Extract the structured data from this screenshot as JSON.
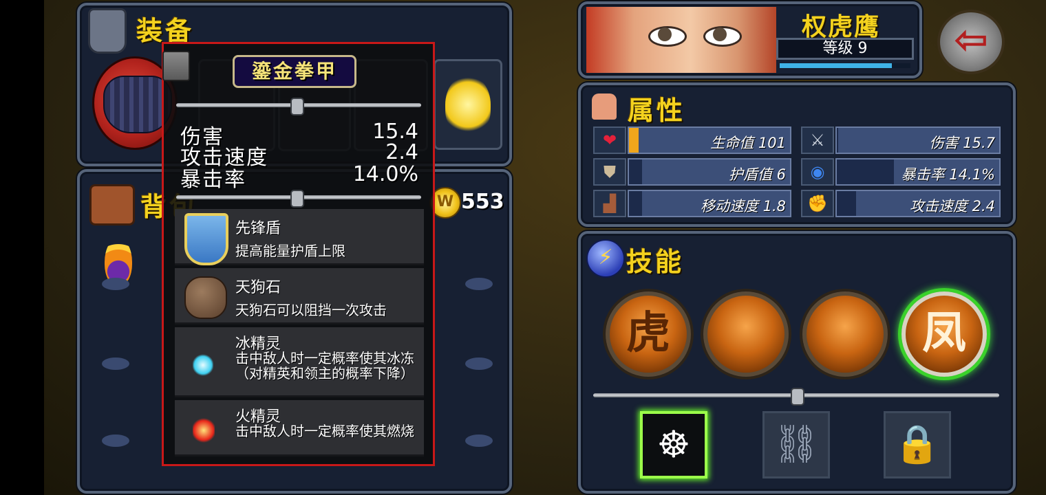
{
  "equipment": {
    "title": "装备"
  },
  "backpack": {
    "title": "背包",
    "coins": "553"
  },
  "tooltip": {
    "item_name": "鎏金拳甲",
    "stats": [
      {
        "label": "伤害",
        "value": "15.4"
      },
      {
        "label": "攻击速度",
        "value": "2.4"
      },
      {
        "label": "暴击率",
        "value": "14.0%"
      }
    ],
    "items": [
      {
        "name": "先锋盾",
        "desc": "提高能量护盾上限",
        "icon": "shield-icon"
      },
      {
        "name": "天狗石",
        "desc": "天狗石可以阻挡一次攻击",
        "icon": "stone-icon"
      },
      {
        "name": "冰精灵",
        "desc": "击中敌人时一定概率使其冰冻（对精英和领主的概率下降）",
        "icon": "ice-spirit-icon"
      },
      {
        "name": "火精灵",
        "desc": "击中敌人时一定概率使其燃烧",
        "icon": "fire-spirit-icon"
      }
    ]
  },
  "character": {
    "name": "权虎鹰",
    "level_text": "等级 9",
    "xp_fraction": 0.86
  },
  "attributes": {
    "title": "属性",
    "list": [
      {
        "label": "生命值 101",
        "icon": "heart-icon",
        "fill": 0.06
      },
      {
        "label": "伤害 15.7",
        "icon": "sword-icon",
        "fill": 0.01
      },
      {
        "label": "护盾值 6",
        "icon": "shield-icon",
        "fill": 0.08
      },
      {
        "label": "暴击率 14.1%",
        "icon": "eye-icon",
        "fill": 0.35
      },
      {
        "label": "移动速度 1.8",
        "icon": "boot-icon",
        "fill": 0.08
      },
      {
        "label": "攻击速度 2.4",
        "icon": "fist-icon",
        "fill": 0.12
      }
    ]
  },
  "skills": {
    "title": "技能",
    "orbs": [
      {
        "glyph": "虎",
        "active": false
      },
      {
        "glyph": "",
        "active": false
      },
      {
        "glyph": "",
        "active": false
      },
      {
        "glyph": "凤",
        "active": true
      }
    ]
  },
  "colors": {
    "accent": "#f4d21e",
    "panel": "#172033",
    "tooltip_border": "#c81818",
    "active_green": "#3ad22a"
  }
}
